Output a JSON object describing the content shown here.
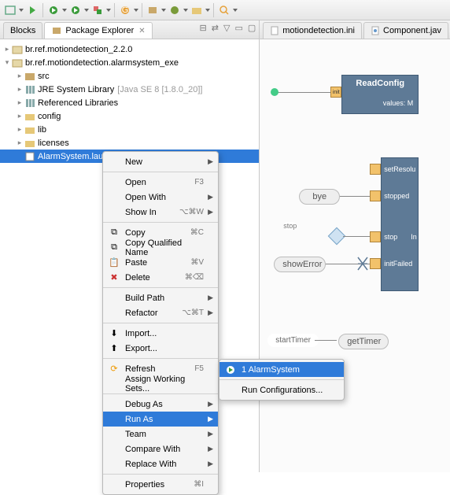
{
  "toolbar": {
    "icons": [
      "perspective",
      "pin",
      "run-last",
      "run",
      "ext-tools",
      "build",
      "debug",
      "skip",
      "search",
      "nav",
      "new-package",
      "new-class"
    ]
  },
  "leftTabs": {
    "blocks": "Blocks",
    "pkgexp": "Package Explorer",
    "x": "✕"
  },
  "tree": {
    "root1": "br.ref.motiondetection_2.2.0",
    "root2": "br.ref.motiondetection.alarmsystem_exe",
    "src": "src",
    "jre": "JRE System Library",
    "jrever": "[Java SE 8 [1.8.0_20]]",
    "reflib": "Referenced Libraries",
    "config": "config",
    "lib": "lib",
    "licenses": "licenses",
    "alarm": "AlarmSystem.launch"
  },
  "menu": {
    "new": "New",
    "open": "Open",
    "open_k": "F3",
    "openwith": "Open With",
    "showin": "Show In",
    "showin_k": "⌥⌘W",
    "copy": "Copy",
    "copy_k": "⌘C",
    "copyq": "Copy Qualified Name",
    "paste": "Paste",
    "paste_k": "⌘V",
    "delete": "Delete",
    "delete_k": "⌘⌫",
    "buildpath": "Build Path",
    "refactor": "Refactor",
    "refactor_k": "⌥⌘T",
    "import": "Import...",
    "export": "Export...",
    "refresh": "Refresh",
    "refresh_k": "F5",
    "assign": "Assign Working Sets...",
    "debugas": "Debug As",
    "runas": "Run As",
    "team": "Team",
    "compare": "Compare With",
    "replace": "Replace With",
    "properties": "Properties",
    "properties_k": "⌘I"
  },
  "submenu": {
    "run1": "1 AlarmSystem",
    "runconfig": "Run Configurations..."
  },
  "editorTabs": {
    "t1": "motiondetection.ini",
    "t2": "Component.jav"
  },
  "diagram": {
    "readconfig": "ReadConfig",
    "readconfig_sub": "values: M",
    "init": "init",
    "setResolu": "setResolu",
    "bye": "bye",
    "stopped": "stopped",
    "stopLabel": "stop",
    "stop2": "stop",
    "in": "In",
    "showError": "showError",
    "initFailed": "initFailed",
    "startTimer": "startTimer",
    "getTimer": "getTimer"
  }
}
